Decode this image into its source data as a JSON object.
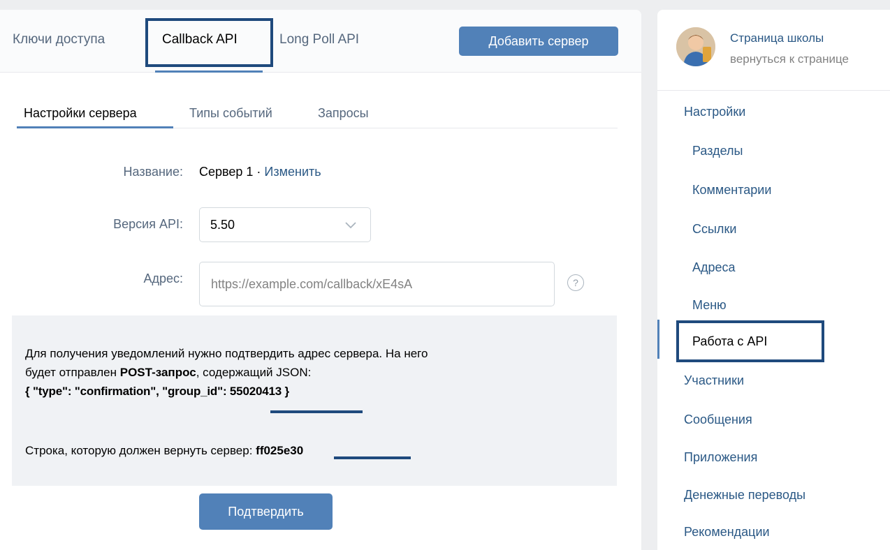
{
  "top_tabs": {
    "keys": "Ключи доступа",
    "callback": "Callback API",
    "longpoll": "Long Poll API",
    "add_server": "Добавить сервер"
  },
  "sub_tabs": {
    "settings": "Настройки сервера",
    "events": "Типы событий",
    "requests": "Запросы"
  },
  "form": {
    "name_label": "Название:",
    "name_value": "Сервер 1",
    "name_sep": " · ",
    "name_change": "Изменить",
    "version_label": "Версия API:",
    "version_value": "5.50",
    "address_label": "Адрес:",
    "address_placeholder": "https://example.com/callback/xE4sA",
    "help": "?"
  },
  "info": {
    "line1": "Для получения уведомлений нужно подтвердить адрес сервера. На него",
    "line2_prefix": "будет отправлен ",
    "line2_bold": "POST-запрос",
    "line2_suffix": ", содержащий JSON:",
    "json": "{ \"type\": \"confirmation\", \"group_id\": 55020413 }",
    "return_prefix": "Строка, которую должен вернуть сервер: ",
    "return_code": "ff025e30",
    "confirm": "Подтвердить"
  },
  "sidebar": {
    "title": "Страница школы",
    "subtitle": "вернуться к странице",
    "settings": "Настройки",
    "items": [
      "Разделы",
      "Комментарии",
      "Ссылки",
      "Адреса",
      "Меню",
      "Работа с API"
    ],
    "other": [
      "Участники",
      "Сообщения",
      "Приложения",
      "Денежные переводы",
      "Рекомендации"
    ]
  },
  "colors": {
    "accent": "#5181b8",
    "highlight": "#1f4a7d",
    "link": "#2a5885"
  }
}
